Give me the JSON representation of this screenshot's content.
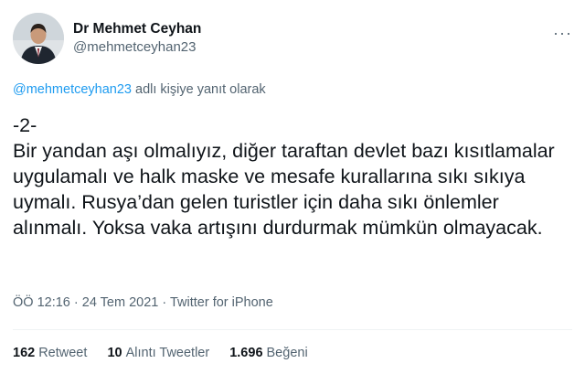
{
  "tweet": {
    "author": {
      "display_name": "Dr Mehmet Ceyhan",
      "handle": "@mehmetceyhan23"
    },
    "more_icon": "more-dots-icon",
    "reply_context": {
      "mention": "@mehmetceyhan23",
      "suffix": " adlı kişiye yanıt olarak"
    },
    "text": "-2-\nBir yandan aşı olmalıyız, diğer taraftan devlet bazı kısıtlamalar uygulamalı ve halk maske ve mesafe kurallarına sıkı sıkıya uymalı. Rusya’dan gelen turistler için daha sıkı önlemler alınmalı. Yoksa vaka artışını durdurmak mümkün olmayacak.",
    "meta": {
      "time": "ÖÖ 12:16",
      "sep1": " · ",
      "date": "24 Tem 2021",
      "sep2": " · ",
      "source": "Twitter for iPhone"
    },
    "stats": {
      "retweets_count": "162",
      "retweets_label": "Retweet",
      "quotes_count": "10",
      "quotes_label": "Alıntı Tweetler",
      "likes_count": "1.696",
      "likes_label": "Beğeni"
    }
  },
  "colors": {
    "link": "#1d9bf0",
    "secondary_text": "#536471",
    "primary_text": "#0f1419"
  }
}
